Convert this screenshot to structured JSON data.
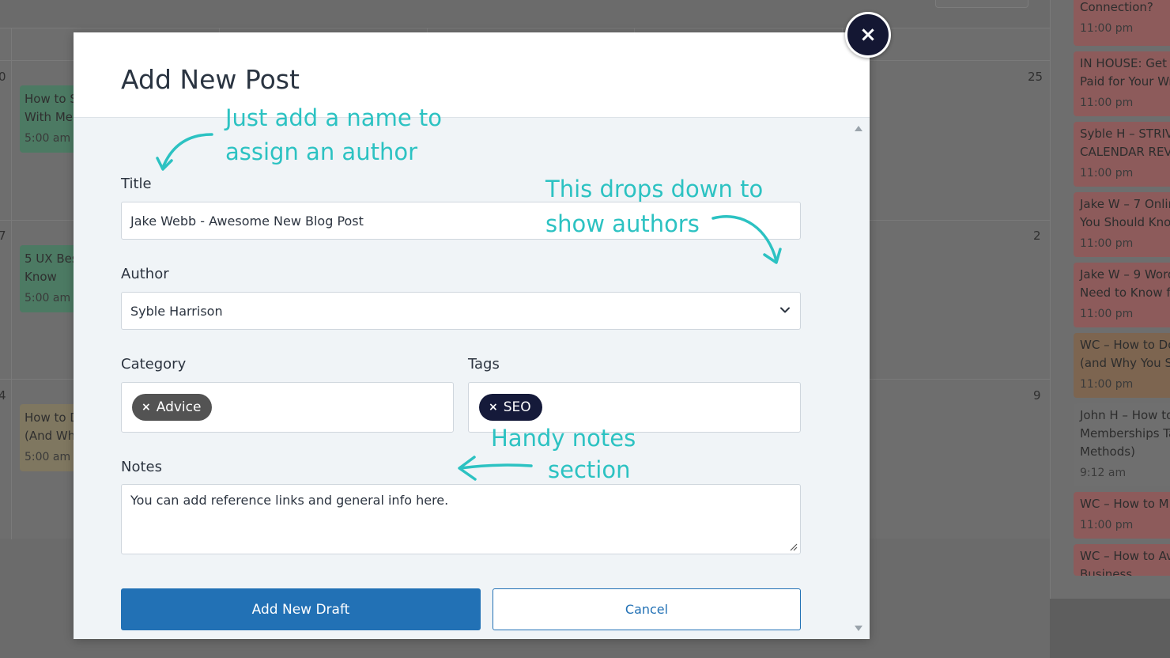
{
  "calendar": {
    "day_numbers": [
      "0",
      "25",
      "7",
      "2",
      "4",
      "9"
    ],
    "events": [
      {
        "title": "How to S",
        "line2": "With Me",
        "time": "5:00 am",
        "color": "#4c7a63"
      },
      {
        "title": "5 UX Bes",
        "line2": "Know",
        "time": "5:00 am",
        "color": "#4c7a63"
      },
      {
        "title": "How to D",
        "line2": "(And Wh",
        "time": "5:00 am",
        "color": "#7f7760"
      }
    ]
  },
  "sidebar": {
    "cards": [
      {
        "line1": "Connection?",
        "line2": "",
        "time": "11:00 pm",
        "color": "#8d5b5b"
      },
      {
        "line1": "IN HOUSE: Get P",
        "line2": "Paid for Your Wr",
        "time": "11:00 pm",
        "color": "#8d5b5b"
      },
      {
        "line1": "Syble H – STRIV",
        "line2": "CALENDAR REV",
        "time": "11:00 pm",
        "color": "#8d5b5b"
      },
      {
        "line1": "Jake W – 7 Onlin",
        "line2": "You Should Kno",
        "time": "11:00 pm",
        "color": "#8d5b5b"
      },
      {
        "line1": "Jake W – 9 Word",
        "line2": "Need to Know fo",
        "time": "11:00 pm",
        "color": "#8d5b5b"
      },
      {
        "line1": "WC – How to Do",
        "line2": "(and Why You S",
        "time": "11:00 pm",
        "color": "#7d6550"
      },
      {
        "line1": "John H – How to",
        "line2": "Memberships Ta",
        "line3": "Methods)",
        "time": "9:12 am",
        "color": "#6f6f6f"
      },
      {
        "line1": "WC – How to M",
        "line2": "",
        "time": "11:00 pm",
        "color": "#8d5b5b"
      },
      {
        "line1": "WC – How to Av",
        "line2": "Business",
        "time": "",
        "color": "#8d5b5b"
      }
    ]
  },
  "modal": {
    "title": "Add New Post",
    "close_label": "×",
    "fields": {
      "title_label": "Title",
      "title_value": "Jake Webb - Awesome New Blog Post",
      "author_label": "Author",
      "author_value": "Syble Harrison",
      "category_label": "Category",
      "category_chip": "Advice",
      "tags_label": "Tags",
      "tags_chip": "SEO",
      "chip_remove": "×",
      "notes_label": "Notes",
      "notes_value": "You can add reference links and general info here."
    },
    "buttons": {
      "add_draft": "Add New Draft",
      "cancel": "Cancel"
    }
  },
  "annotations": {
    "title_note": [
      "Just add a name to",
      "assign an author"
    ],
    "author_note": [
      "This drops down to",
      "show authors"
    ],
    "notes_note": [
      "Handy notes",
      "section"
    ],
    "color": "#2cc2c2"
  },
  "colors": {
    "primary": "#2271b5",
    "chip_gray": "#535353",
    "chip_navy": "#151a3a",
    "close_bg": "#141733"
  }
}
